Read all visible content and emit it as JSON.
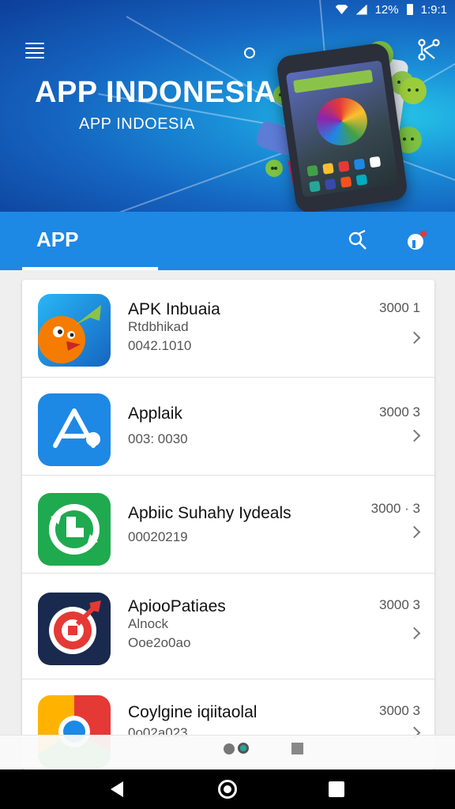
{
  "status_bar": {
    "battery": "12%",
    "time": "1:9:1"
  },
  "header": {
    "title": "APP INDONESIA",
    "subtitle": "APP INDOESIA"
  },
  "tabs": {
    "active": "APP"
  },
  "icons": {
    "menu": "hamburger-menu-icon",
    "share": "share-icon",
    "search": "search-icon",
    "notifications": "notification-icon"
  },
  "apps": [
    {
      "name": "APK Inbuaia",
      "subtitle": "Rtdbhikad",
      "date": "0042.1010",
      "meta": "3000  1",
      "icon": "orange-bird-icon",
      "color": "#1e88e5"
    },
    {
      "name": "Applaik",
      "subtitle": "",
      "date": "003: 0030",
      "meta": "3000  3",
      "icon": "app-store-icon",
      "color": "#1e88e5"
    },
    {
      "name": "Apbiic Suhahy Iydeals",
      "subtitle": "",
      "date": "00020219",
      "meta": "3000 · 3",
      "icon": "green-sync-icon",
      "color": "#1faa4f"
    },
    {
      "name": "ApiooPatiaes",
      "subtitle": "Alnock",
      "date": "Ooe2o0ao",
      "meta": "3000  3",
      "icon": "target-icon",
      "color": "#1a2a4e"
    },
    {
      "name": "Coylgine iqiitaolal",
      "subtitle": "",
      "date": "0o02a023",
      "meta": "3000  3",
      "icon": "chrome-like-icon",
      "color": "#ffb300"
    }
  ],
  "colors": {
    "primary": "#1e88e5",
    "banner_dark": "#0d3e9a",
    "banner_light": "#26c6e8"
  }
}
